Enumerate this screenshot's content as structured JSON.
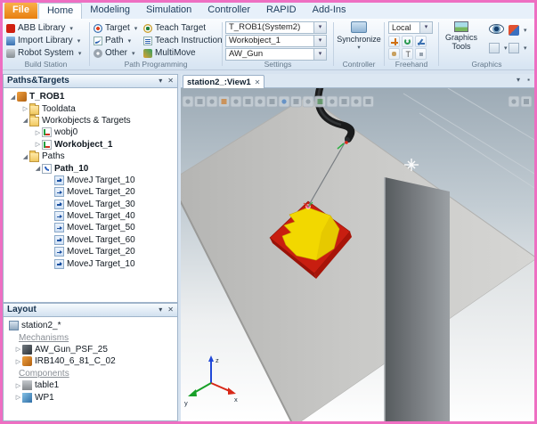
{
  "colors": {
    "window_border": "#ee6fc2",
    "file_tab_orange": "#e87f10",
    "workpiece_red": "#c81e10",
    "workpiece_yellow": "#f2d800",
    "axis_x_red": "#d82818",
    "axis_y_green": "#18a028",
    "axis_z_blue": "#2048d8"
  },
  "icons": {
    "dropdown": "▾",
    "collapsed": "▷",
    "expanded": "◢",
    "close": "✕",
    "menu": "▾",
    "small_square": "▪"
  },
  "ribbon": {
    "tabs": [
      {
        "label": "File"
      },
      {
        "label": "Home"
      },
      {
        "label": "Modeling"
      },
      {
        "label": "Simulation"
      },
      {
        "label": "Controller"
      },
      {
        "label": "RAPID"
      },
      {
        "label": "Add-Ins"
      }
    ],
    "groups": {
      "build_station": {
        "label": "Build Station",
        "items": [
          {
            "label": "ABB Library",
            "icon": "abb-icon"
          },
          {
            "label": "Import Library",
            "icon": "import-library-icon"
          },
          {
            "label": "Robot System",
            "icon": "robot-system-icon"
          }
        ]
      },
      "path_programming": {
        "label": "Path Programming",
        "items": [
          {
            "label": "Target",
            "icon": "target-icon"
          },
          {
            "label": "Path",
            "icon": "path-icon"
          },
          {
            "label": "Other",
            "icon": "gear-icon"
          },
          {
            "label": "Teach Target",
            "icon": "teach-target-icon"
          },
          {
            "label": "Teach Instruction",
            "icon": "teach-instruction-icon"
          },
          {
            "label": "MultiMove",
            "icon": "multimove-icon"
          }
        ]
      },
      "settings": {
        "label": "Settings",
        "task": "T_ROB1(System2)",
        "workobject": "Workobject_1",
        "tool": "AW_Gun"
      },
      "controller": {
        "label": "Controller",
        "synchronize": "Synchronize"
      },
      "freehand": {
        "label": "Freehand",
        "reference": "Local"
      },
      "graphics": {
        "label": "Graphics",
        "tools_line1": "Graphics",
        "tools_line2": "Tools"
      }
    }
  },
  "paths_panel": {
    "title": "Paths&Targets",
    "tree": [
      {
        "arrow": "◢",
        "label": "T_ROB1",
        "icon": "robot-icon"
      },
      {
        "arrow": "▷",
        "label": "Tooldata",
        "icon": "folder-icon"
      },
      {
        "arrow": "◢",
        "label": "Workobjects & Targets",
        "icon": "folder-icon"
      },
      {
        "arrow": "▷",
        "label": "wobj0",
        "icon": "workobject-icon"
      },
      {
        "arrow": "▷",
        "label": "Workobject_1",
        "icon": "workobject-icon"
      },
      {
        "arrow": "◢",
        "label": "Paths",
        "icon": "folder-icon"
      },
      {
        "arrow": "◢",
        "label": "Path_10",
        "icon": "path-icon"
      },
      {
        "arrow": "",
        "label": "MoveJ Target_10",
        "icon": "move-instruction-icon"
      },
      {
        "arrow": "",
        "label": "MoveL Target_20",
        "icon": "move-instruction-icon"
      },
      {
        "arrow": "",
        "label": "MoveL Target_30",
        "icon": "move-instruction-icon"
      },
      {
        "arrow": "",
        "label": "MoveL Target_40",
        "icon": "move-instruction-icon"
      },
      {
        "arrow": "",
        "label": "MoveL Target_50",
        "icon": "move-instruction-icon"
      },
      {
        "arrow": "",
        "label": "MoveL Target_60",
        "icon": "move-instruction-icon"
      },
      {
        "arrow": "",
        "label": "MoveL Target_20",
        "icon": "move-instruction-icon"
      },
      {
        "arrow": "",
        "label": "MoveJ Target_10",
        "icon": "move-instruction-icon"
      }
    ]
  },
  "layout_panel": {
    "title": "Layout",
    "station": "station2_*",
    "sections": [
      {
        "label": "Mechanisms"
      },
      {
        "label": "Components"
      }
    ],
    "mechanisms": [
      {
        "arrow": "▷",
        "label": "AW_Gun_PSF_25",
        "icon": "gun-icon"
      },
      {
        "arrow": "▷",
        "label": "IRB140_6_81_C_02",
        "icon": "robot-icon"
      }
    ],
    "components": [
      {
        "arrow": "▷",
        "label": "table1",
        "icon": "table-icon"
      },
      {
        "arrow": "▷",
        "label": "WP1",
        "icon": "part-icon"
      }
    ]
  },
  "viewport": {
    "tab_title": "station2_:View1",
    "axes": {
      "x": "x",
      "y": "y",
      "z": "z"
    }
  }
}
